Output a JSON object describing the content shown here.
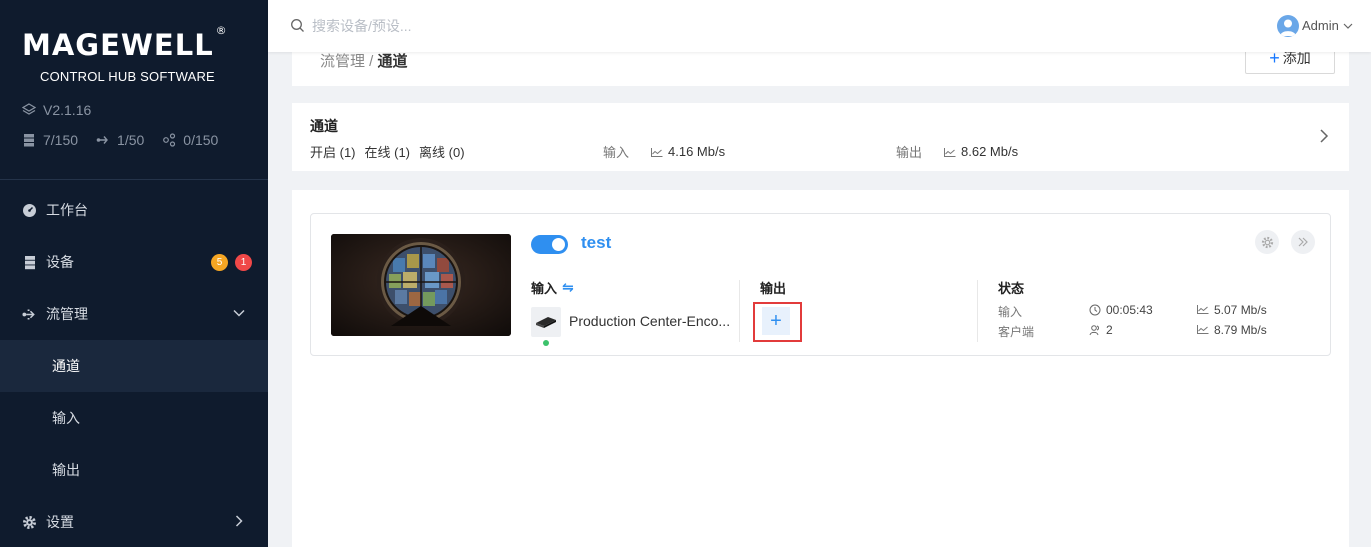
{
  "sidebar": {
    "brand": "MAGEWELL",
    "brand_mark": "®",
    "subtitle": "CONTROL HUB SOFTWARE",
    "version": "V2.1.16",
    "stats": [
      "7/150",
      "1/50",
      "0/150"
    ],
    "nav": {
      "dashboard": "工作台",
      "devices": "设备",
      "devices_badge_warning": "5",
      "devices_badge_error": "1",
      "stream_mgmt": "流管理",
      "channels": "通道",
      "inputs": "输入",
      "outputs": "输出",
      "settings": "设置"
    }
  },
  "topbar": {
    "search_placeholder": "搜索设备/预设...",
    "user": "Admin"
  },
  "breadcrumb": {
    "parent": "流管理 / ",
    "current": "通道",
    "add_label": "添加"
  },
  "summary": {
    "title": "通道",
    "enabled": "开启 (1)",
    "online": "在线 (1)",
    "offline": "离线 (0)",
    "input_label": "输入",
    "input_rate": "4.16 Mb/s",
    "output_label": "输出",
    "output_rate": "8.62 Mb/s"
  },
  "channel": {
    "name": "test",
    "enabled": true,
    "input_header": "输入",
    "input_device": "Production Center-Enco...",
    "output_header": "输出",
    "status_header": "状态",
    "status": {
      "input_label": "输入",
      "clients_label": "客户端",
      "duration": "00:05:43",
      "clients": "2",
      "input_rate": "5.07 Mb/s",
      "output_rate": "8.79 Mb/s"
    }
  },
  "colors": {
    "sidebar_bg": "#0f1b2d",
    "accent": "#2f8ff0",
    "badge_warning": "#f5a623",
    "badge_error": "#f04848",
    "online": "#3cc26b",
    "highlight": "#e23b3b"
  }
}
